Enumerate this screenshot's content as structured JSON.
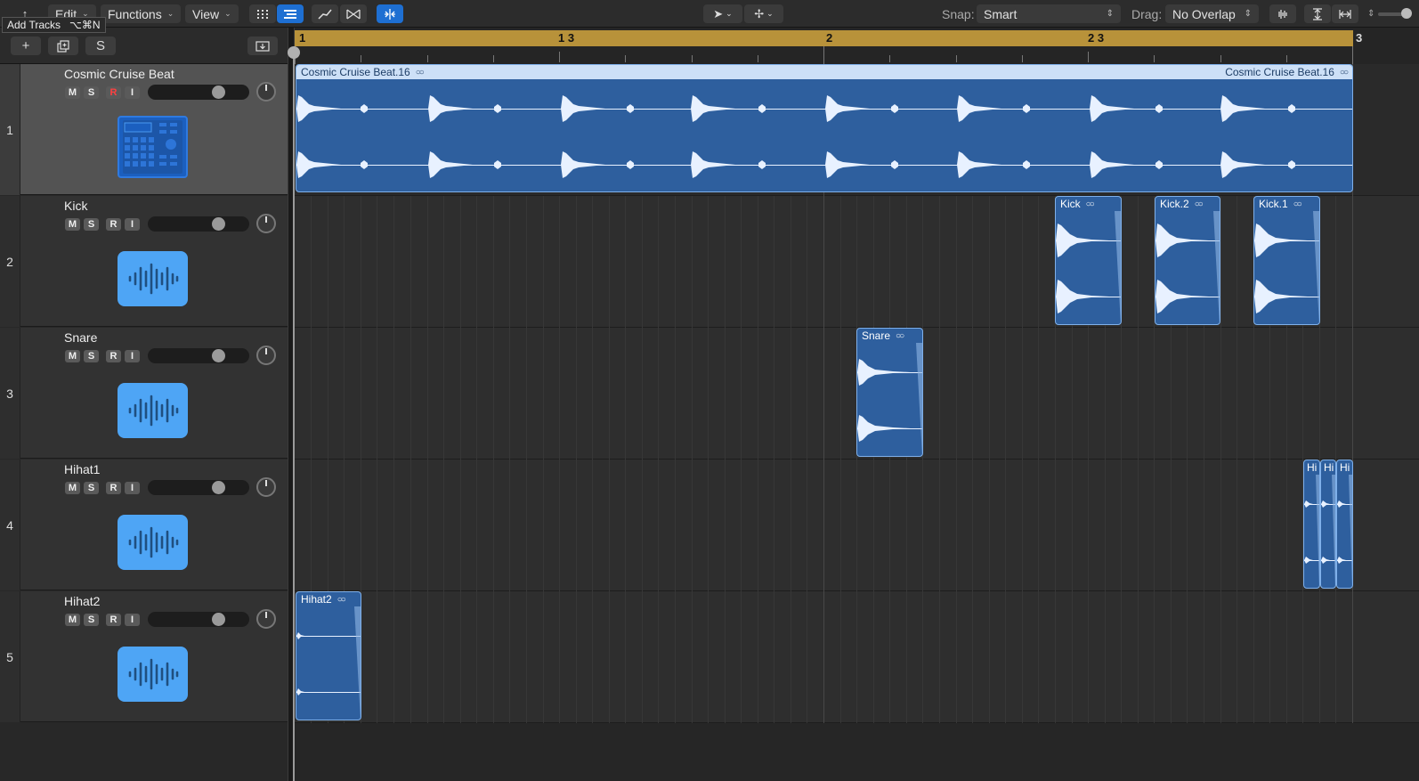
{
  "toolbar": {
    "edit_label": "Edit",
    "functions_label": "Functions",
    "view_label": "View",
    "snap_label": "Snap:",
    "snap_value": "Smart",
    "drag_label": "Drag:",
    "drag_value": "No Overlap"
  },
  "tooltip": {
    "text": "Add Tracks",
    "shortcut": "⌥⌘N"
  },
  "header_toolbar": {
    "add_label": "+",
    "solo_label": "S"
  },
  "tracks": [
    {
      "number": "1",
      "name": "Cosmic Cruise Beat",
      "icon": "drum-machine-icon",
      "selected": true,
      "record_armed": true
    },
    {
      "number": "2",
      "name": "Kick",
      "icon": "waveform-icon",
      "selected": false,
      "record_armed": false
    },
    {
      "number": "3",
      "name": "Snare",
      "icon": "waveform-icon",
      "selected": false,
      "record_armed": false
    },
    {
      "number": "4",
      "name": "Hihat1",
      "icon": "waveform-icon",
      "selected": false,
      "record_armed": false
    },
    {
      "number": "5",
      "name": "Hihat2",
      "icon": "waveform-icon",
      "selected": false,
      "record_armed": false
    }
  ],
  "track_buttons": {
    "mute": "M",
    "solo": "S",
    "record": "R",
    "input": "I"
  },
  "ruler": {
    "markers": [
      "1",
      "1 3",
      "2",
      "2 3",
      "3"
    ]
  },
  "regions": {
    "beat_1": "Cosmic Cruise Beat.16",
    "beat_2": "Cosmic Cruise Beat.16",
    "kick_a": "Kick",
    "kick_b": "Kick.2",
    "kick_c": "Kick.1",
    "snare": "Snare",
    "hihat1_a": "Hi",
    "hihat1_b": "Hi",
    "hihat1_c": "Hi",
    "hihat2": "Hihat2"
  },
  "colors": {
    "region_fill": "#2e5f9e",
    "region_border": "#7fb0ea",
    "cycle_bar": "#b8923a",
    "accent": "#1e6fd2",
    "track_icon": "#4ea5f5"
  }
}
